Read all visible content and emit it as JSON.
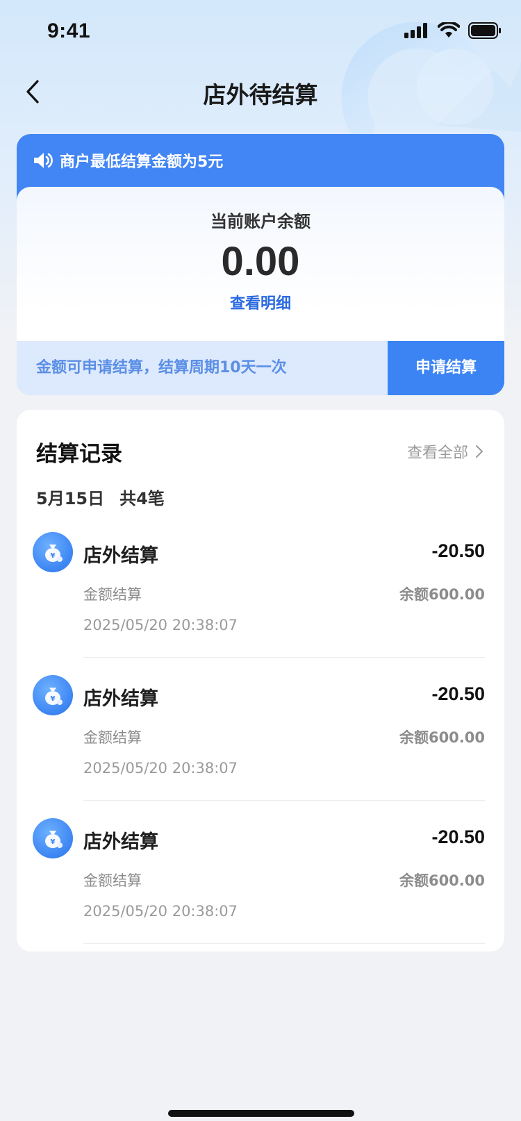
{
  "status_bar": {
    "time": "9:41"
  },
  "nav": {
    "title": "店外待结算",
    "back_icon": "chevron-left-icon"
  },
  "balance_card": {
    "notice": "商户最低结算金额为5元",
    "notice_icon": "speaker-icon",
    "label": "当前账户余额",
    "value": "0.00",
    "view_detail": "查看明细",
    "settle_note": "金额可申请结算，结算周期10天一次",
    "apply_button": "申请结算"
  },
  "records": {
    "title": "结算记录",
    "view_all": "查看全部",
    "date": "5月15日",
    "count": "共4笔",
    "items": [
      {
        "title": "店外结算",
        "amount": "-20.50",
        "subtitle": "金额结算",
        "balance": "余额600.00",
        "time": "2025/05/20 20:38:07",
        "icon": "money-bag-icon"
      },
      {
        "title": "店外结算",
        "amount": "-20.50",
        "subtitle": "金额结算",
        "balance": "余额600.00",
        "time": "2025/05/20 20:38:07",
        "icon": "money-bag-icon"
      },
      {
        "title": "店外结算",
        "amount": "-20.50",
        "subtitle": "金额结算",
        "balance": "余额600.00",
        "time": "2025/05/20 20:38:07",
        "icon": "money-bag-icon"
      }
    ]
  },
  "colors": {
    "accent": "#4285f4",
    "link": "#2b6be0",
    "settle_bar": "#dde9fc",
    "page_bg": "#f1f2f5"
  }
}
